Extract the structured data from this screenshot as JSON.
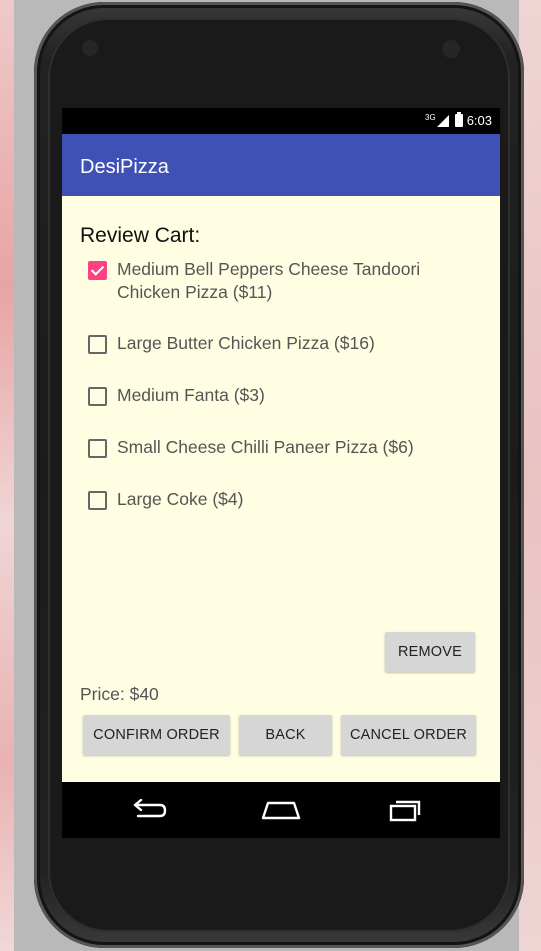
{
  "status_bar": {
    "time": "6:03",
    "network": "3G"
  },
  "app_bar": {
    "title": "DesiPizza"
  },
  "cart": {
    "heading": "Review Cart:",
    "items": [
      {
        "label": "Medium Bell Peppers Cheese Tandoori Chicken Pizza ($11)",
        "checked": true
      },
      {
        "label": "Large Butter Chicken Pizza ($16)",
        "checked": false
      },
      {
        "label": "Medium Fanta ($3)",
        "checked": false
      },
      {
        "label": "Small Cheese Chilli Paneer Pizza ($6)",
        "checked": false
      },
      {
        "label": "Large Coke ($4)",
        "checked": false
      }
    ]
  },
  "actions": {
    "remove_label": "REMOVE",
    "price_label": "Price: $40",
    "confirm_label": "CONFIRM ORDER",
    "back_label": "BACK",
    "cancel_label": "CANCEL ORDER"
  },
  "icons": {
    "nav_back": "back-arrow-icon",
    "nav_home": "home-icon",
    "nav_recents": "recents-icon"
  },
  "colors": {
    "app_bar": "#3f51b5",
    "accent": "#ff4081",
    "screen_background": "#fffee3",
    "button": "#d6d6d6"
  }
}
